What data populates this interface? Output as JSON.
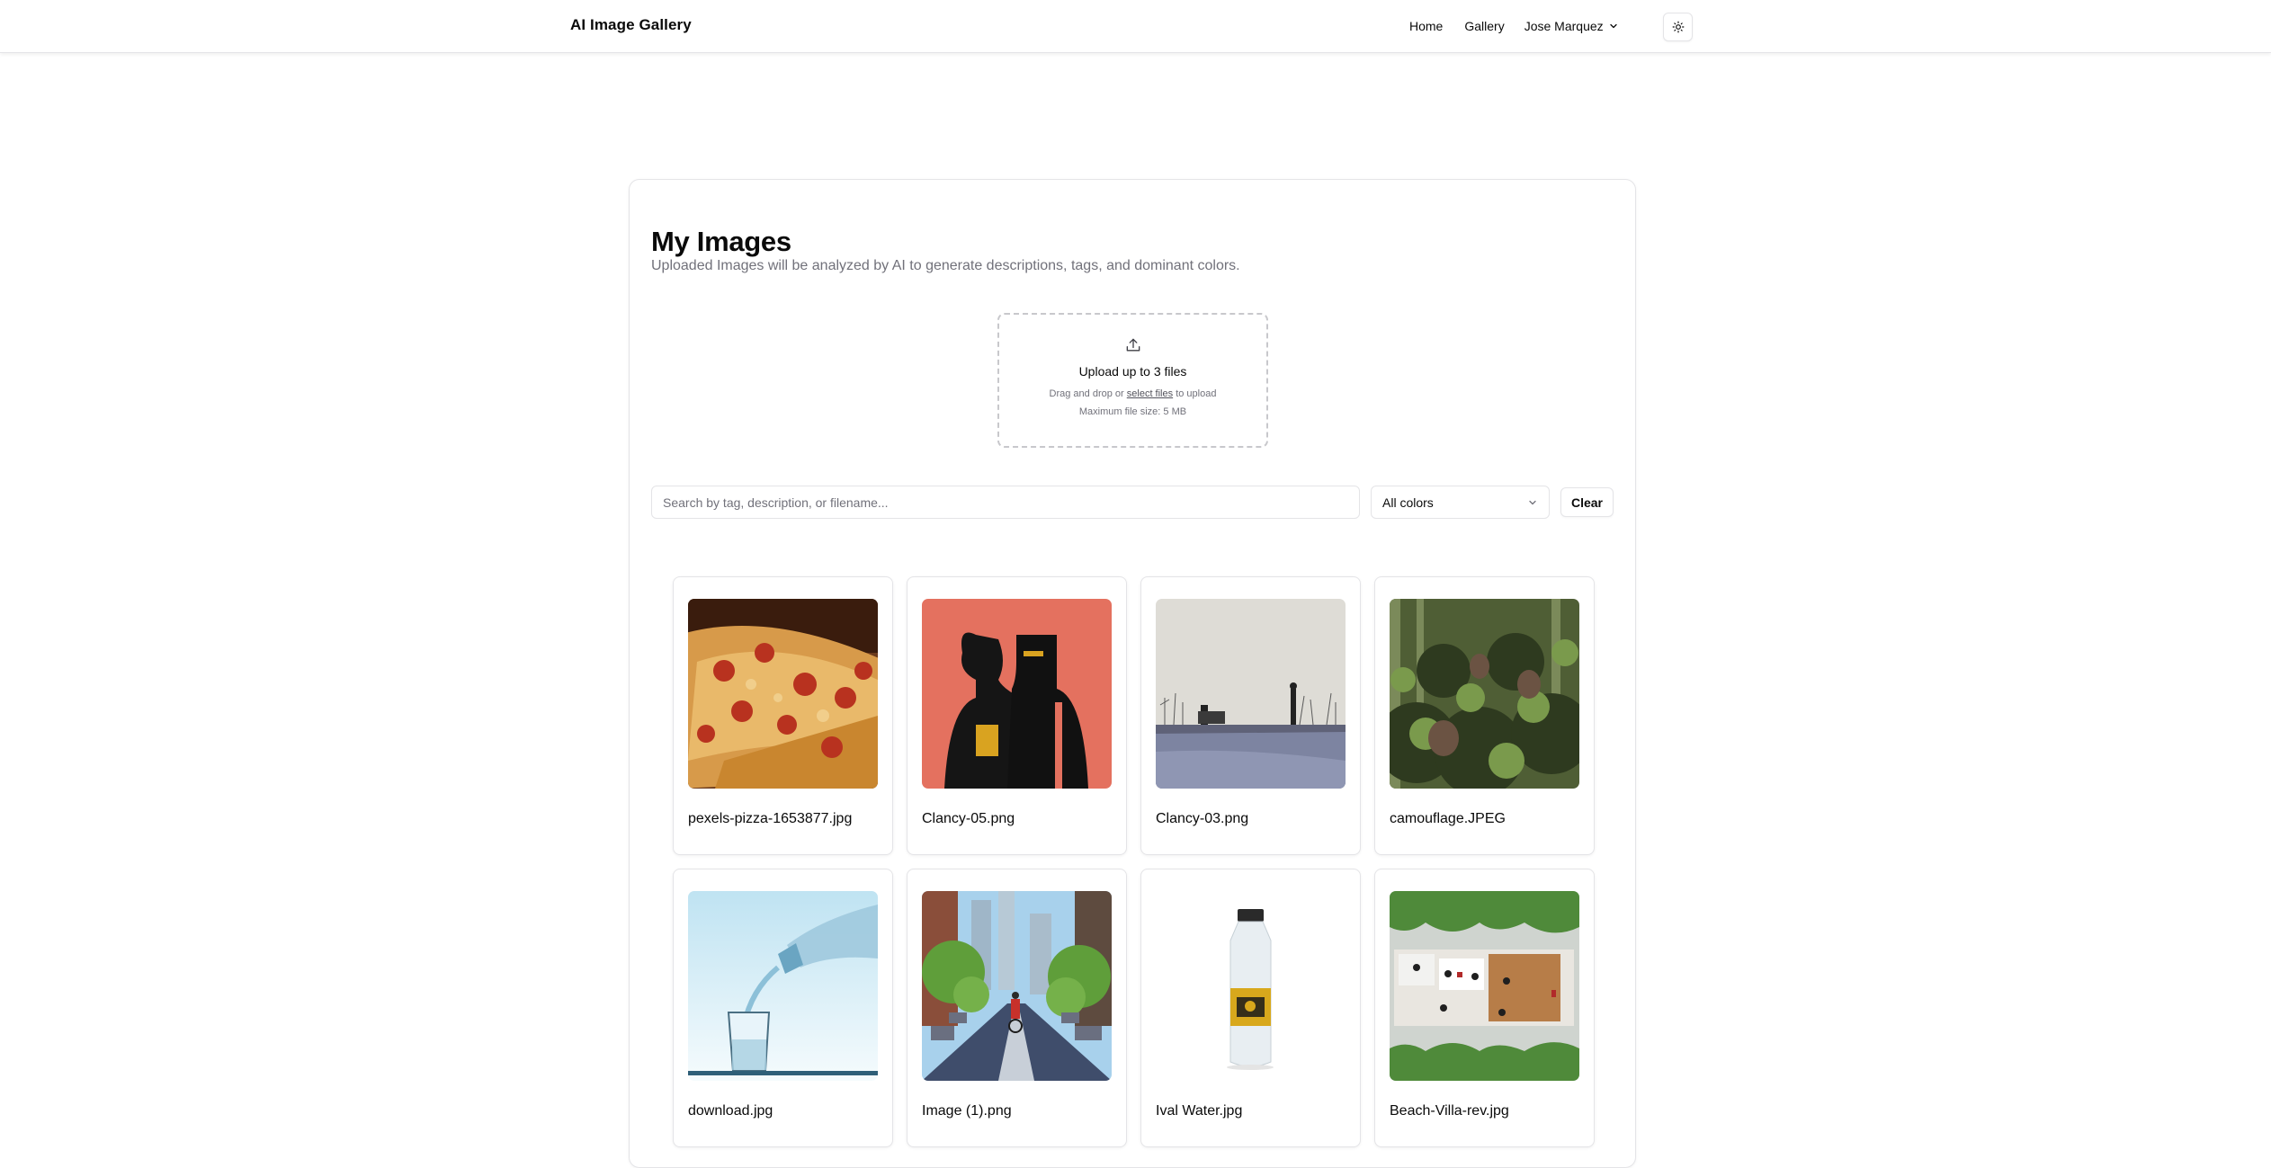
{
  "app": {
    "title": "AI Image Gallery"
  },
  "nav": {
    "links": [
      "Home",
      "Gallery"
    ],
    "user_name": "Jose Marquez",
    "theme_icon": "sun-icon"
  },
  "main": {
    "title": "My Images",
    "subtitle": "Uploaded Images will be analyzed by AI to generate descriptions, tags, and dominant colors."
  },
  "upload": {
    "icon": "upload-icon",
    "title": "Upload up to 3 files",
    "hint_prefix": "Drag and drop or",
    "hint_link": "select files",
    "hint_suffix": "to upload",
    "max_size": "Maximum file size: 5 MB"
  },
  "filters": {
    "search_placeholder": "Search by tag, description, or filename...",
    "search_value": "",
    "color_selected": "All colors",
    "clear_label": "Clear"
  },
  "images": [
    {
      "filename": "pexels-pizza-1653877.jpg",
      "thumb": "pizza"
    },
    {
      "filename": "Clancy-05.png",
      "thumb": "clancy-red"
    },
    {
      "filename": "Clancy-03.png",
      "thumb": "clancy-snow"
    },
    {
      "filename": "camouflage.JPEG",
      "thumb": "camouflage"
    },
    {
      "filename": "download.jpg",
      "thumb": "water-pour"
    },
    {
      "filename": "Image (1).png",
      "thumb": "city-cyclist"
    },
    {
      "filename": "Ival Water.jpg",
      "thumb": "water-bottle"
    },
    {
      "filename": "Beach-Villa-rev.jpg",
      "thumb": "villa-plan"
    }
  ]
}
